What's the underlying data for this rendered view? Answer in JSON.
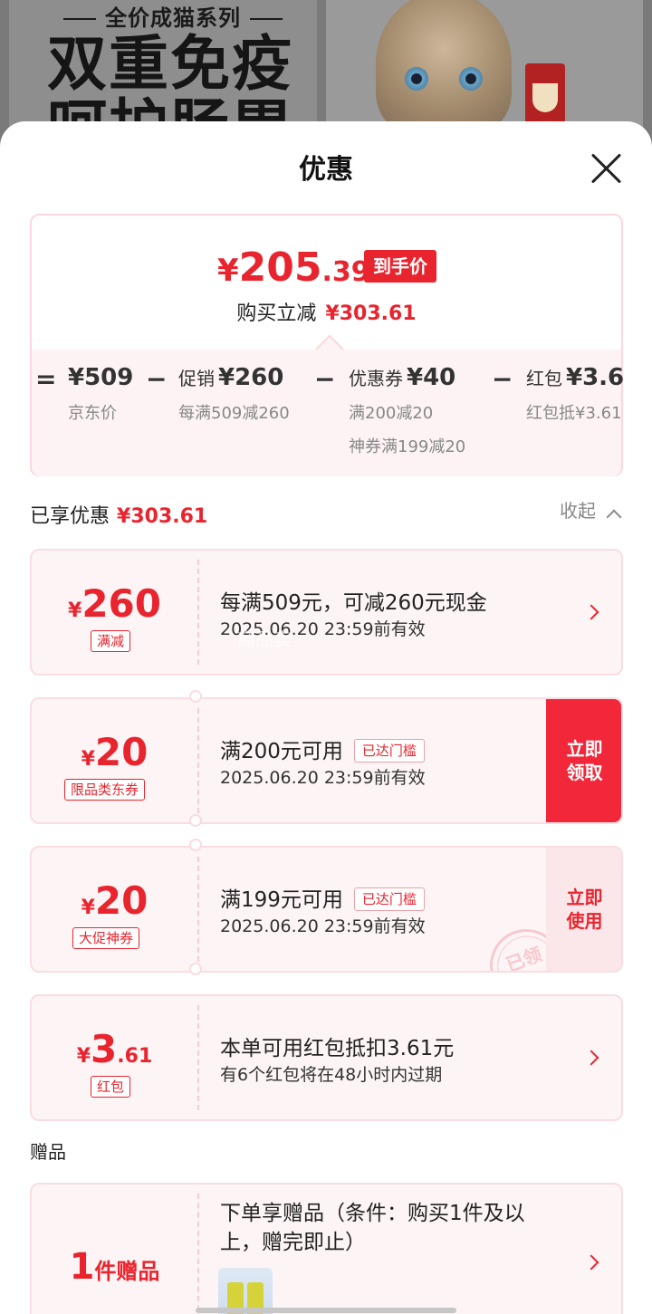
{
  "banner": {
    "series": "全价成猫系列",
    "headline_line1": "双重免疫",
    "headline_line2": "呵护肠胃"
  },
  "sheet": {
    "title": "优惠"
  },
  "summary": {
    "final_yen": "¥",
    "final_int": "205",
    "final_dec": ".39",
    "final_tag": "到手价",
    "instant_label": "购买立减",
    "instant_amount": "¥303.61",
    "breakdown": [
      {
        "op": "=",
        "label": "",
        "value": "¥509",
        "subs": [
          "京东价"
        ]
      },
      {
        "op": "−",
        "label": "促销",
        "value": "¥260",
        "subs": [
          "每满509减260"
        ]
      },
      {
        "op": "−",
        "label": "优惠券",
        "value": "¥40",
        "subs": [
          "满200减20",
          "神券满199减20"
        ]
      },
      {
        "op": "−",
        "label": "红包",
        "value": "¥3.6",
        "subs": [
          "红包抵¥3.61"
        ]
      }
    ]
  },
  "enjoyed": {
    "label": "已享优惠",
    "amount": "¥303.61",
    "collapse": "收起"
  },
  "coupons": [
    {
      "yen": "¥",
      "big": "260",
      "small": "",
      "tag": "满减",
      "title": "每满509元，可减260元现金",
      "desc": "2025.06.20 23:59前有效",
      "threshold": "",
      "action": ""
    },
    {
      "yen": "¥",
      "big": "20",
      "small": "",
      "tag": "限品类东券",
      "title": "满200元可用",
      "desc": "2025.06.20 23:59前有效",
      "threshold": "已达门槛",
      "action_line1": "立即",
      "action_line2": "领取"
    },
    {
      "yen": "¥",
      "big": "20",
      "small": "",
      "tag": "大促神券",
      "title": "满199元可用",
      "desc": "2025.06.20 23:59前有效",
      "threshold": "已达门槛",
      "action_line1": "立即",
      "action_line2": "使用",
      "stamp": "已领"
    },
    {
      "yen": "¥",
      "big": "3",
      "small": ".61",
      "tag": "红包",
      "title": "本单可用红包抵扣3.61元",
      "desc": "有6个红包将在48小时内过期",
      "threshold": "",
      "action": ""
    }
  ],
  "watermark": "商品卖",
  "gifts": {
    "heading": "赠品",
    "count_num": "1",
    "count_txt": "件赠品",
    "title": "下单享赠品（条件：购买1件及以上，赠完即止）"
  },
  "colors": {
    "accent": "#e8252f",
    "card_bg": "#fdf4f5",
    "card_border": "#f9dde1"
  }
}
